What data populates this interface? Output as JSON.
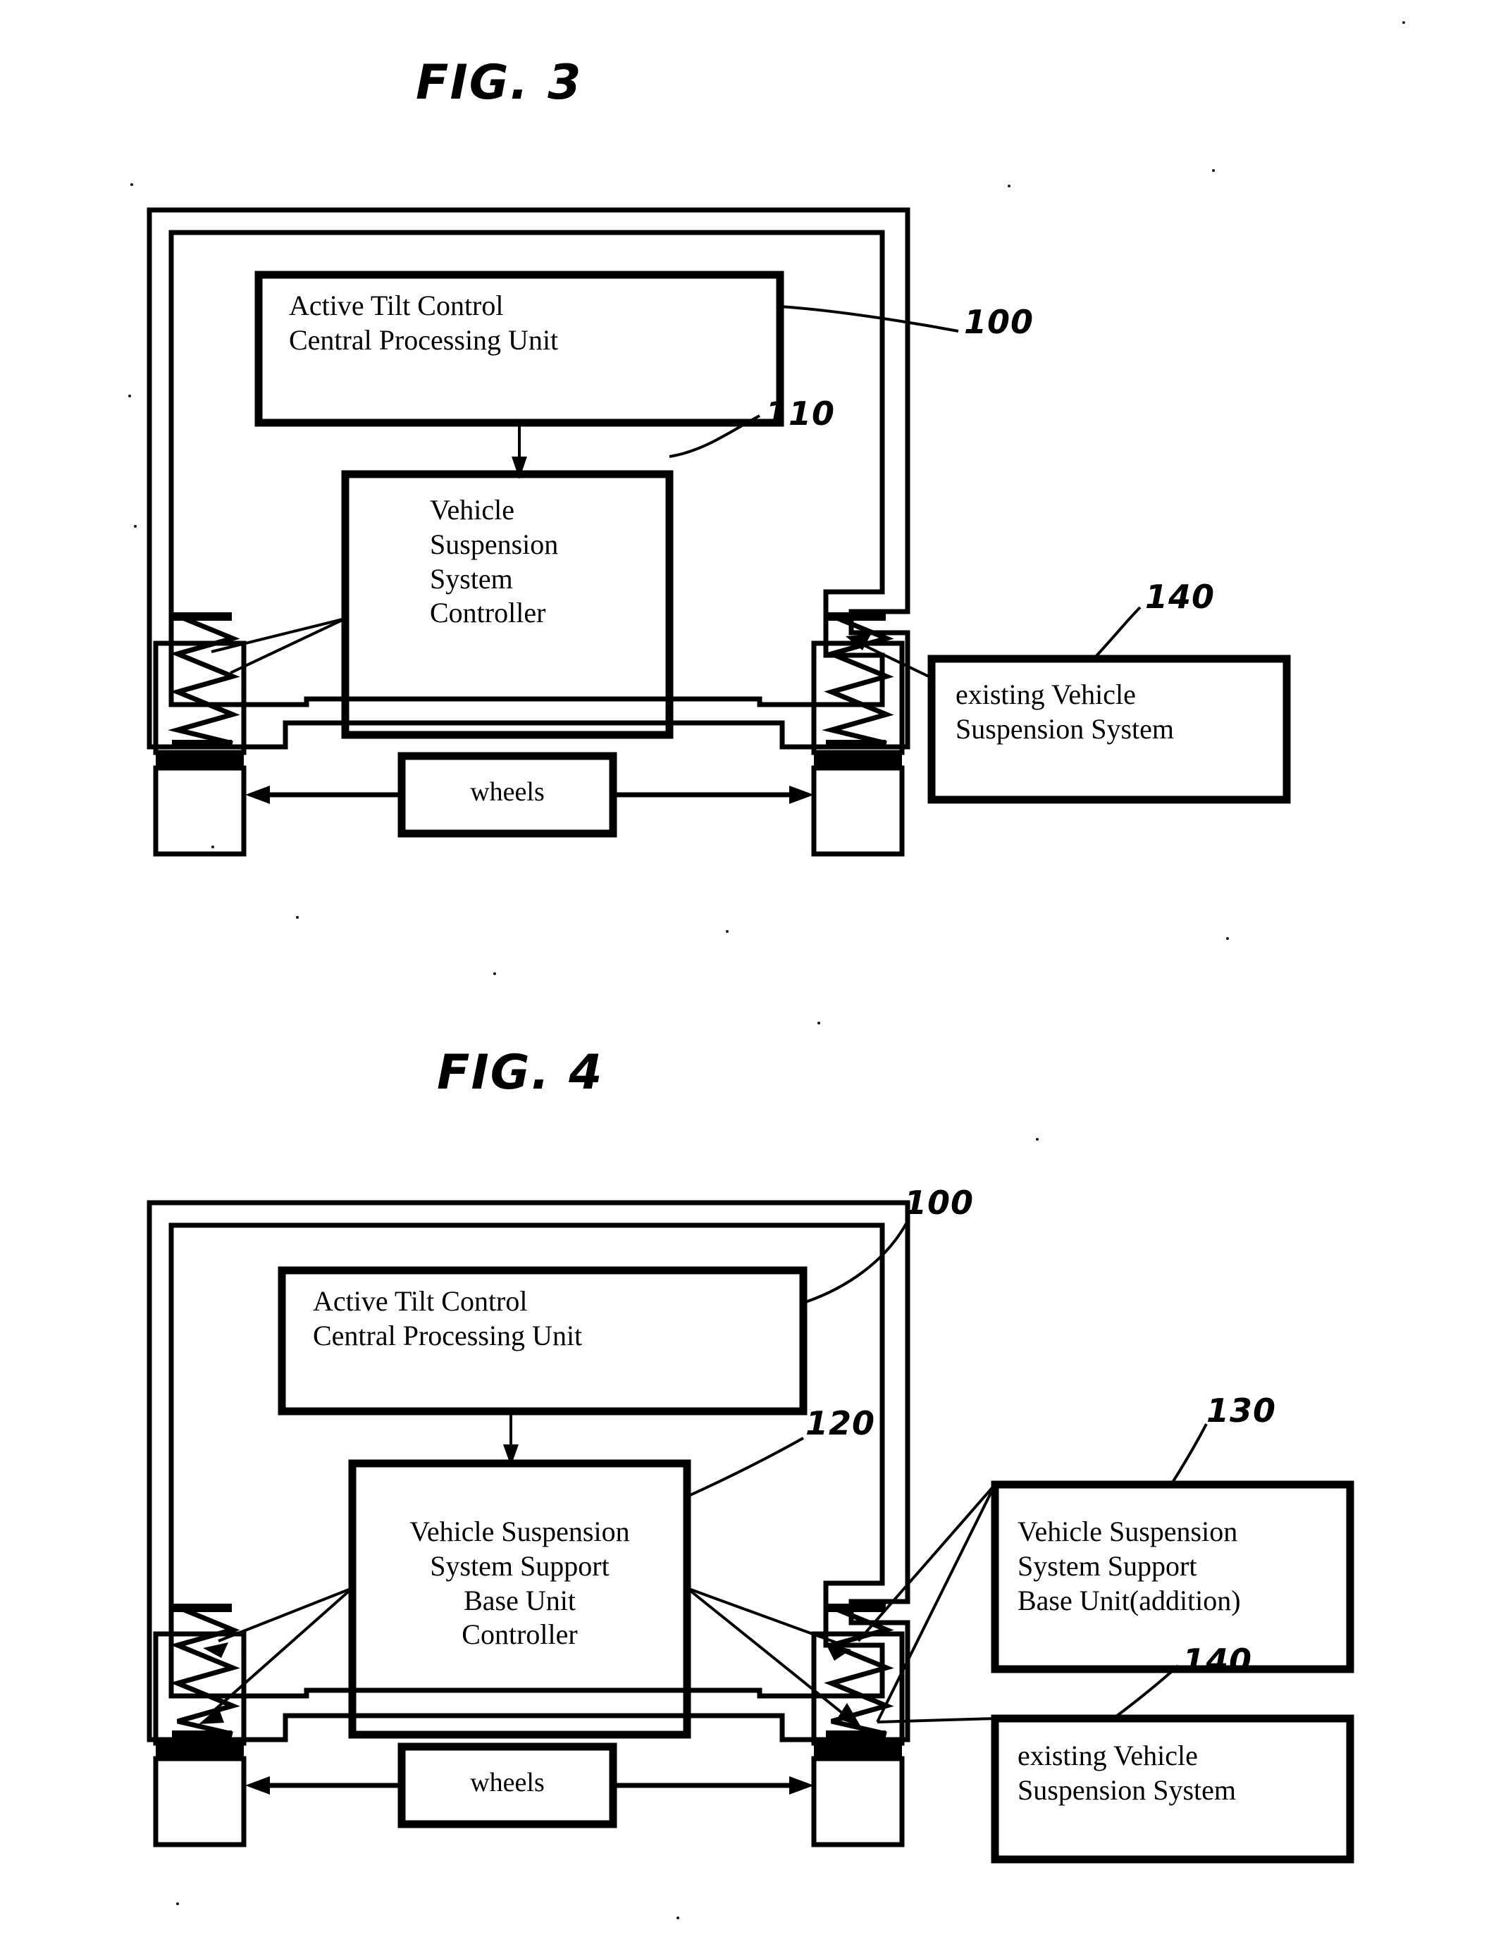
{
  "document": {
    "type": "patent-drawing-sheet",
    "figures": [
      {
        "id": "fig3",
        "title": "FIG. 3",
        "boxes": {
          "cpu": "Active Tilt Control\nCentral  Processing Unit",
          "cpu_line1": "Active Tilt Control",
          "cpu_line2": "Central  Processing Unit",
          "controller_line1": "Vehicle",
          "controller_line2": "Suspension",
          "controller_line3": "System",
          "controller_line4": "Controller",
          "wheels": "wheels",
          "existing_line1": "existing Vehicle",
          "existing_line2": "Suspension System"
        },
        "reference_numerals": {
          "chassis": "100",
          "controller": "110",
          "existing_suspension": "140"
        }
      },
      {
        "id": "fig4",
        "title": "FIG. 4",
        "boxes": {
          "cpu_line1": "Active Tilt Control",
          "cpu_line2": "Central Processing Unit",
          "controller_line1": "Vehicle Suspension",
          "controller_line2": "System Support",
          "controller_line3": "Base  Unit",
          "controller_line4": "Controller",
          "wheels": "wheels",
          "addition_line1": "Vehicle Suspension",
          "addition_line2": "System Support",
          "addition_line3": "Base Unit(addition)",
          "existing_line1": "existing Vehicle",
          "existing_line2": "Suspension System"
        },
        "reference_numerals": {
          "chassis": "100",
          "base_unit_controller": "120",
          "support_base_unit_addition": "130",
          "existing_suspension": "140"
        }
      }
    ],
    "colors": {
      "ink": "#000000",
      "paper": "#ffffff"
    }
  }
}
